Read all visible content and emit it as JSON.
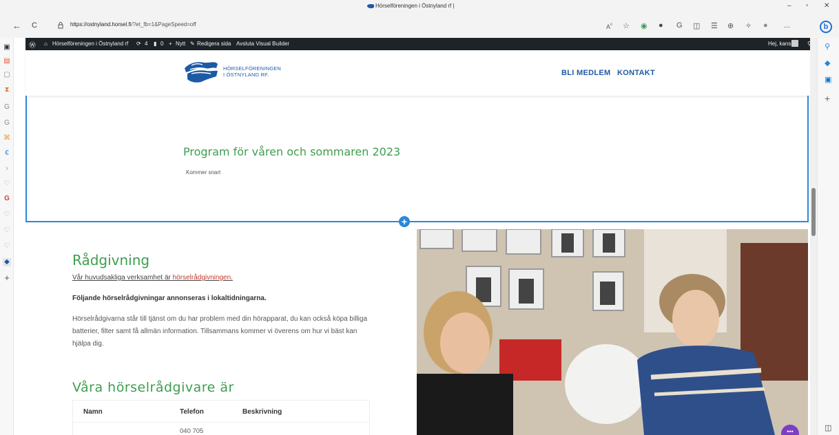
{
  "window": {
    "title": "Hörselföreningen i Östnyland rf |",
    "minimize": "–",
    "restore": "▫",
    "close": "✕"
  },
  "addressbar": {
    "back": "←",
    "reload": "C",
    "url_host": "https://ostnyland.horsel.fi",
    "url_path": "/?et_fb=1&PageSpeed=off",
    "more": "..."
  },
  "wpadmin": {
    "site_name": "Hörselföreningen i Östnyland rf",
    "updates_count": "4",
    "comments_count": "0",
    "new_label": "Nytt",
    "edit_label": "Redigera sida",
    "exit_builder_label": "Avsluta Visual Builder",
    "greeting": "Hej, kansli"
  },
  "header": {
    "logo_line1": "HÖRSELFÖRENINGEN",
    "logo_line2": "I ÖSTNYLAND RF.",
    "nav": [
      "BLI MEDLEM",
      "KONTAKT"
    ]
  },
  "program": {
    "title": "Program för våren och sommaren 2023",
    "subtitle": "Kommer snart"
  },
  "radgivning": {
    "title": "Rådgivning",
    "p1_prefix": "Vår huvudsakliga verksamhet är ",
    "p1_link": "hörselrådgivningen.",
    "p2": "Följande hörselrådgivningar annonseras i lokaltidningarna.",
    "p3": "Hörselrådgivarna står till tjänst om du har problem med din hörapparat, du kan också köpa billiga batterier, filter samt få allmän information. Tillsammans kommer vi överens om hur vi bäst kan hjälpa dig."
  },
  "advisors": {
    "title": "Våra hörselrådgivare är",
    "columns": [
      "Namn",
      "Telefon",
      "Beskrivning"
    ],
    "row1_phone": "040 705"
  },
  "colors": {
    "accent_green": "#3e9e4e",
    "brand_blue": "#1d5aa6",
    "builder_blue": "#2b87da",
    "link_red": "#c0392b"
  }
}
